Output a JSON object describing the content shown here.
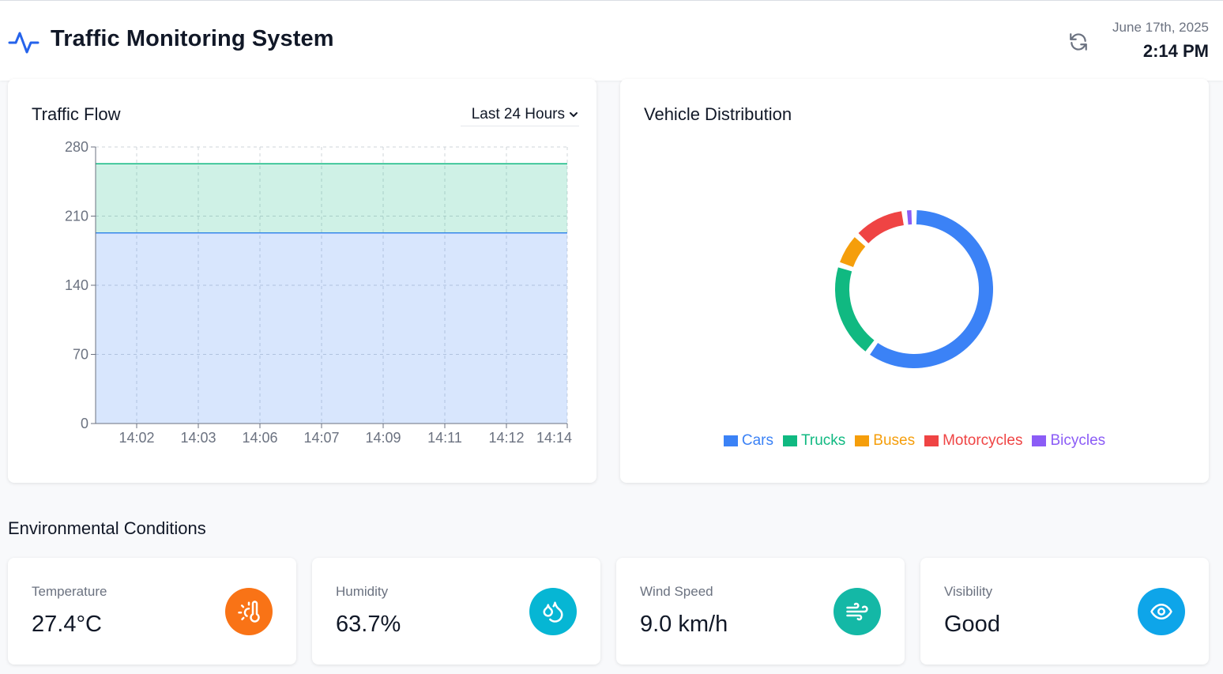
{
  "header": {
    "title": "Traffic Monitoring System",
    "date": "June 17th, 2025",
    "time": "2:14 PM",
    "logo_icon": "activity-pulse-icon",
    "refresh_icon": "refresh-icon"
  },
  "traffic_flow": {
    "title": "Traffic Flow",
    "range_selected": "Last 24 Hours"
  },
  "vehicle_distribution": {
    "title": "Vehicle Distribution"
  },
  "environment": {
    "title": "Environmental Conditions",
    "cards": [
      {
        "label": "Temperature",
        "value": "27.4°C",
        "icon": "thermometer-sun-icon",
        "color": "#f97316"
      },
      {
        "label": "Humidity",
        "value": "63.7%",
        "icon": "droplets-icon",
        "color": "#06b6d4"
      },
      {
        "label": "Wind Speed",
        "value": "9.0 km/h",
        "icon": "wind-icon",
        "color": "#14b8a6"
      },
      {
        "label": "Visibility",
        "value": "Good",
        "icon": "eye-icon",
        "color": "#0ea5e9"
      }
    ]
  },
  "chart_data": [
    {
      "type": "area",
      "title": "",
      "xlabel": "",
      "ylabel": "",
      "x": [
        "14:02",
        "14:03",
        "14:06",
        "14:07",
        "14:09",
        "14:11",
        "14:12",
        "14:14"
      ],
      "ylim": [
        0,
        280
      ],
      "yticks": [
        0,
        70,
        140,
        210,
        280
      ],
      "grid": true,
      "stacked": true,
      "series": [
        {
          "values": [
            193,
            193,
            193,
            193,
            193,
            193,
            193,
            193
          ],
          "color": "#3b82f6"
        },
        {
          "values": [
            70,
            70,
            70,
            70,
            70,
            70,
            70,
            70
          ],
          "color": "#10b981"
        }
      ]
    },
    {
      "type": "pie",
      "title": "",
      "donut": true,
      "legend": "bottom",
      "labels": [
        "Cars",
        "Trucks",
        "Buses",
        "Motorcycles",
        "Bicycles"
      ],
      "values": [
        60,
        20,
        7,
        11,
        2
      ],
      "colors": [
        "#3b82f6",
        "#10b981",
        "#f59e0b",
        "#ef4444",
        "#8b5cf6"
      ]
    }
  ]
}
